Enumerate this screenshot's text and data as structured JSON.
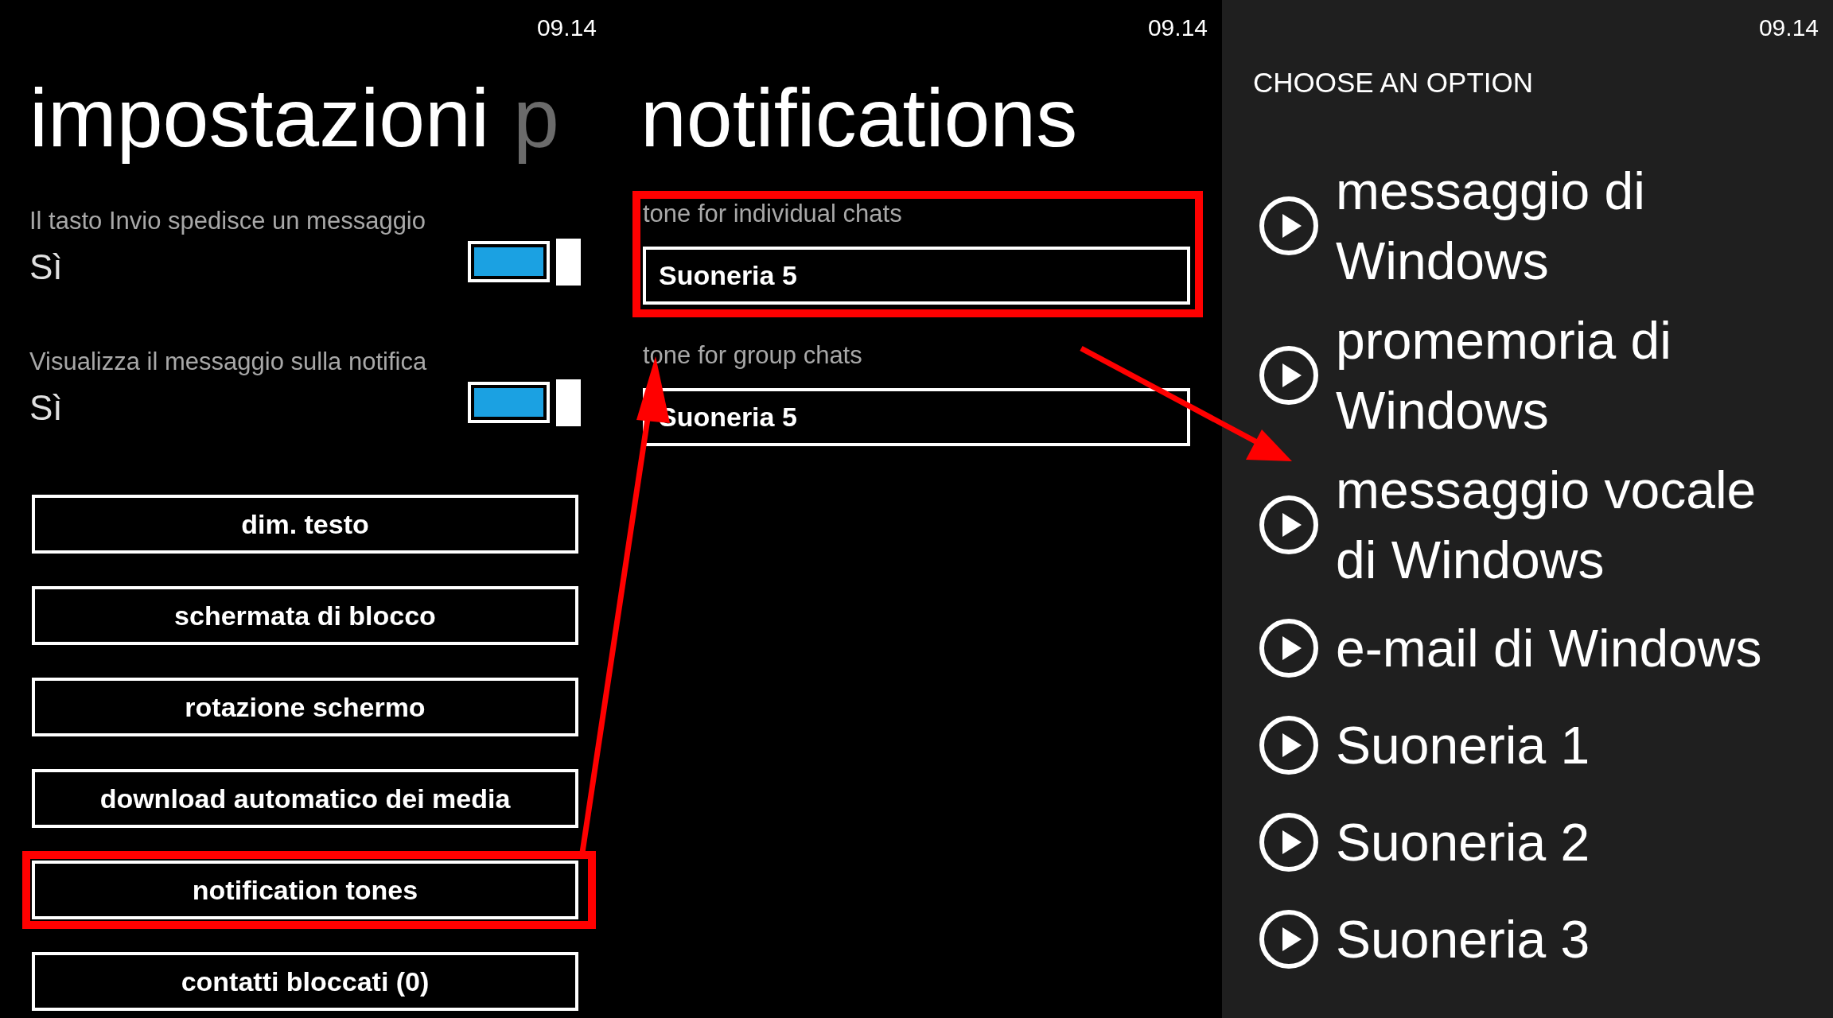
{
  "screens": [
    {
      "kind": "settings",
      "time": "09.14",
      "title": "impostazioni",
      "title_next": "p",
      "toggles": [
        {
          "label": "Il tasto Invio spedisce un messaggio",
          "value": "Sì",
          "on": true
        },
        {
          "label": "Visualizza il messaggio sulla notifica",
          "value": "Sì",
          "on": true
        }
      ],
      "buttons": [
        {
          "label": "dim. testo",
          "highlighted": false
        },
        {
          "label": "schermata di blocco",
          "highlighted": false
        },
        {
          "label": "rotazione schermo",
          "highlighted": false
        },
        {
          "label": "download automatico dei media",
          "highlighted": false
        },
        {
          "label": "notification tones",
          "highlighted": true
        },
        {
          "label": "contatti bloccati (0)",
          "highlighted": false
        }
      ]
    },
    {
      "kind": "notifications",
      "time": "09.14",
      "title": "notifications",
      "pickers": [
        {
          "label": "tone for individual chats",
          "value": "Suoneria 5",
          "highlighted": true
        },
        {
          "label": "tone for group chats",
          "value": "Suoneria 5",
          "highlighted": false
        }
      ]
    },
    {
      "kind": "picker",
      "time": "09.14",
      "header": "CHOOSE AN OPTION",
      "options": [
        {
          "label": "messaggio di Windows"
        },
        {
          "label": "promemoria di Windows"
        },
        {
          "label": "messaggio vocale di Windows"
        },
        {
          "label": "e-mail di Windows"
        },
        {
          "label": "Suoneria 1"
        },
        {
          "label": "Suoneria 2"
        },
        {
          "label": "Suoneria 3"
        }
      ]
    }
  ]
}
